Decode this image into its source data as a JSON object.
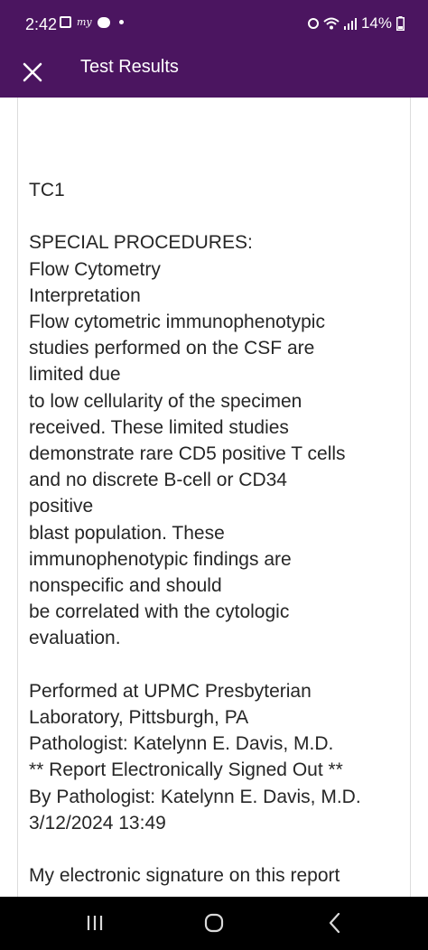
{
  "status_bar": {
    "time": "2:42",
    "battery": "14%",
    "left_icons": [
      "image-icon",
      "app-notification-icon",
      "chat-icon",
      "dot-icon"
    ],
    "right_icons": [
      "alarm-icon",
      "wifi-icon",
      "signal-icon",
      "battery-icon"
    ]
  },
  "app_bar": {
    "title": "Test Results",
    "close_icon": "close-icon",
    "background_color": "#4b1560"
  },
  "report": {
    "text": "TC1\n\nSPECIAL PROCEDURES:\nFlow Cytometry\nInterpretation\nFlow cytometric immunophenotypic\nstudies performed on the CSF are\nlimited due\nto low cellularity of the specimen\nreceived. These limited studies\ndemonstrate rare CD5 positive T cells\nand no discrete B-cell or CD34\npositive\nblast population. These\nimmunophenotypic findings are\nnonspecific and should\nbe correlated with the cytologic\nevaluation.\n\nPerformed at UPMC Presbyterian\nLaboratory, Pittsburgh, PA\nPathologist: Katelynn E. Davis, M.D.\n** Report Electronically Signed Out **\nBy Pathologist: Katelynn E. Davis, M.D.\n3/12/2024 13:49\n\nMy electronic signature on this report"
  },
  "nav_bar": {
    "buttons": [
      "recent-apps-icon",
      "home-icon",
      "back-icon"
    ]
  }
}
